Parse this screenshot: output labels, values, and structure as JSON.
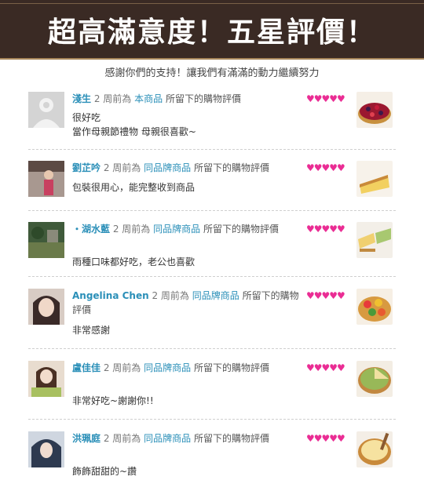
{
  "banner": {
    "title": "超高滿意度！五星評價！"
  },
  "subtitle": "感謝你們的支持！讓我們有滿滿的動力繼續努力",
  "review_template": {
    "ago": "2 周前為",
    "suffix": "所留下的購物評價"
  },
  "reviews": [
    {
      "name": "淺生",
      "shop": "本商品",
      "text": [
        "很好吃",
        "當作母親節禮物 母親很喜歡~"
      ],
      "rating": "♥♥♥♥♥",
      "avatar": "default-avatar",
      "thumb": "berry-tart"
    },
    {
      "name": "劉芷吟",
      "shop": "同品牌商品",
      "text": [
        "包裝很用心，能完整收到商品"
      ],
      "rating": "♥♥♥♥♥",
      "avatar": "girl-photo",
      "thumb": "egg-tart-slice"
    },
    {
      "name": "・湖水藍",
      "shop": "同品牌商品",
      "text": [
        "雨種口味都好吃，老公也喜歡"
      ],
      "rating": "♥♥♥♥♥",
      "avatar": "scenery-photo",
      "thumb": "matcha-tart-slices"
    },
    {
      "name": "Angelina Chen",
      "shop": "同品牌商品",
      "text": [
        "非常感謝"
      ],
      "rating": "♥♥♥♥♥",
      "avatar": "woman-portrait",
      "thumb": "fruit-tart"
    },
    {
      "name": "盧佳佳",
      "shop": "同品牌商品",
      "text": [
        "非常好吃~謝謝你!!"
      ],
      "rating": "♥♥♥♥♥",
      "avatar": "girl-cake-photo",
      "thumb": "matcha-tart"
    },
    {
      "name": "洪珮庭",
      "shop": "同品牌商品",
      "text": [
        "飾飾甜甜的~讚"
      ],
      "rating": "♥♥♥♥♥",
      "avatar": "hoodie-photo",
      "thumb": "custard-tart"
    }
  ]
}
